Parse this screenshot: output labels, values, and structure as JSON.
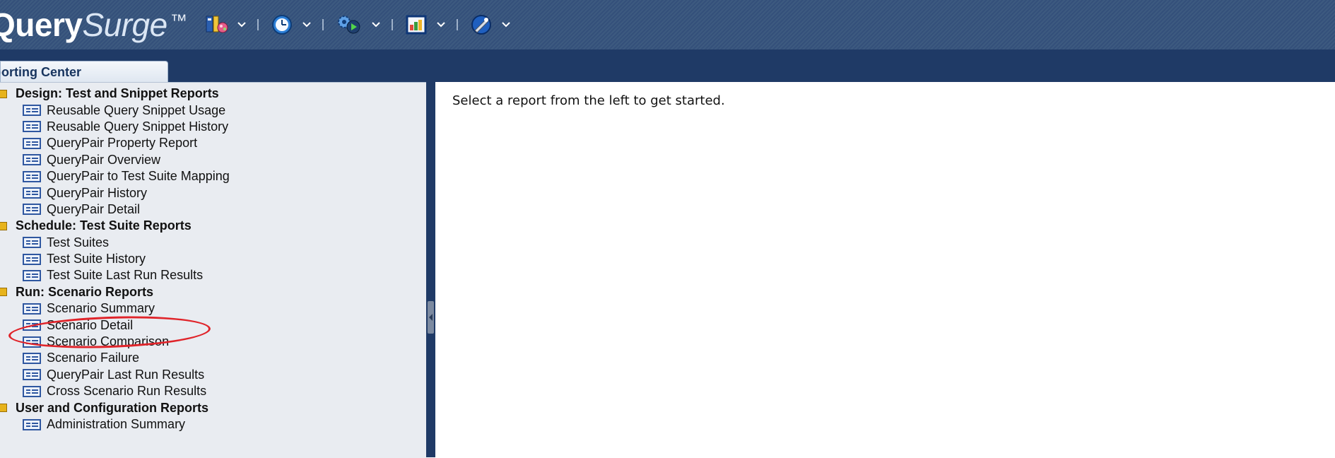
{
  "app": {
    "logo_query": "Query",
    "logo_surge": "Surge",
    "logo_tm": "™"
  },
  "toolbar": {
    "items": [
      {
        "icon": "design-library-icon"
      },
      {
        "icon": "schedule-clock-icon"
      },
      {
        "icon": "run-gears-icon"
      },
      {
        "icon": "reports-chart-icon"
      },
      {
        "icon": "admin-tools-icon"
      }
    ]
  },
  "tab": {
    "label": "porting Center"
  },
  "tree": {
    "categories": [
      {
        "label": "Design: Test and Snippet Reports",
        "items": [
          "Reusable Query Snippet Usage",
          "Reusable Query Snippet History",
          "QueryPair Property Report",
          "QueryPair Overview",
          "QueryPair to Test Suite Mapping",
          "QueryPair History",
          "QueryPair Detail"
        ]
      },
      {
        "label": "Schedule: Test Suite Reports",
        "items": [
          "Test Suites",
          "Test Suite History",
          "Test Suite Last Run Results"
        ]
      },
      {
        "label": "Run: Scenario Reports",
        "items": [
          "Scenario Summary",
          "Scenario Detail",
          "Scenario Comparison",
          "Scenario Failure",
          "QueryPair Last Run Results",
          "Cross Scenario Run Results"
        ]
      },
      {
        "label": "User and Configuration Reports",
        "items": [
          "Administration Summary"
        ]
      }
    ]
  },
  "content": {
    "hint": "Select a report from the left to get started."
  },
  "colors": {
    "header_bg": "#3d5a80",
    "tab_strip_bg": "#1f3a66",
    "panel_bg": "#e9ecf1",
    "annotation_red": "#e0242a"
  }
}
